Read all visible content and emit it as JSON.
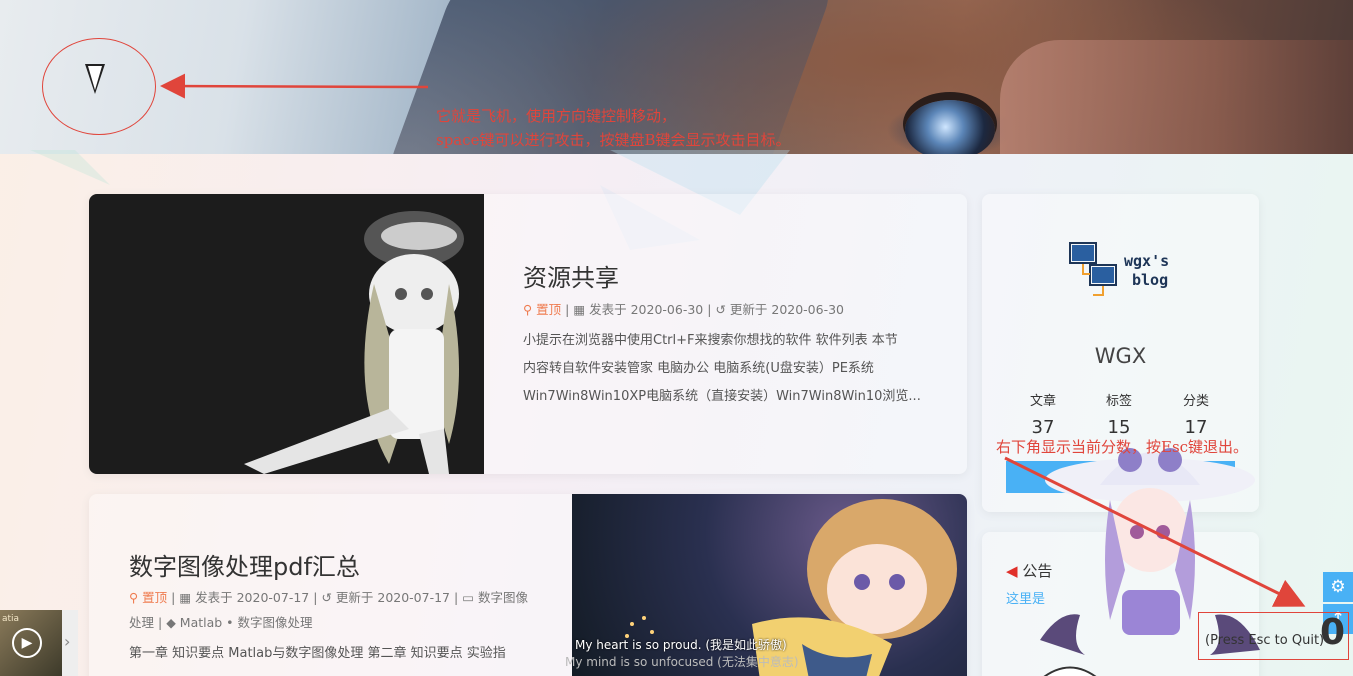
{
  "annotations": {
    "ship_note_line1": "它就是飞机，使用方向键控制移动，",
    "ship_note_line2": "space键可以进行攻击，按键盘B键会显示攻击目标。",
    "score_note": "右下角显示当前分数，按Esc键退出。"
  },
  "posts": [
    {
      "title": "资源共享",
      "pinned": "置顶",
      "posted": "发表于 2020-06-30",
      "updated": "更新于 2020-06-30",
      "excerpt_lines": [
        "小提示在浏览器中使用Ctrl+F来搜索你想找的软件 软件列表 本节",
        "内容转自软件安装管家 电脑办公 电脑系统(U盘安装）PE系统",
        "Win7Win8Win10XP电脑系统（直接安装）Win7Win8Win10浏览..."
      ]
    },
    {
      "title": "数字图像处理pdf汇总",
      "pinned": "置顶",
      "posted": "发表于 2020-07-17",
      "updated": "更新于 2020-07-17",
      "category_1": "数字图像",
      "category_2": "处理",
      "tags": "Matlab • 数字图像处理",
      "excerpt_lines": [
        "第一章 知识要点 Matlab与数字图像处理 第二章 知识要点 实验指"
      ]
    }
  ],
  "sidebar": {
    "logo_line1": "wgx's",
    "logo_line2": "blog",
    "author": "WGX",
    "stats": [
      {
        "label": "文章",
        "value": "37"
      },
      {
        "label": "标签",
        "value": "15"
      },
      {
        "label": "分类",
        "value": "17"
      }
    ],
    "notice_title": "公告",
    "notice_text": "这里是"
  },
  "player": {
    "cover_text": "atia"
  },
  "lyrics": {
    "line1": "My heart is so proud. (我是如此骄傲)",
    "line2": "My mind is so unfocused (无法集中意志)"
  },
  "game": {
    "quit_hint": "(Press Esc to Quit)",
    "score": "0"
  },
  "colors": {
    "accent": "#49b1f5",
    "pinned": "#ef7b4f",
    "annotation": "#e0453b"
  },
  "icons": {
    "pin": "pin-icon",
    "calendar": "calendar-icon",
    "history": "history-icon",
    "folder": "folder-open-icon",
    "tag": "tag-icon",
    "megaphone": "megaphone-icon",
    "gear": "gear-icon",
    "arrow_up": "arrow-up-icon",
    "play": "play-icon",
    "chevron_right": "chevron-right-icon"
  }
}
